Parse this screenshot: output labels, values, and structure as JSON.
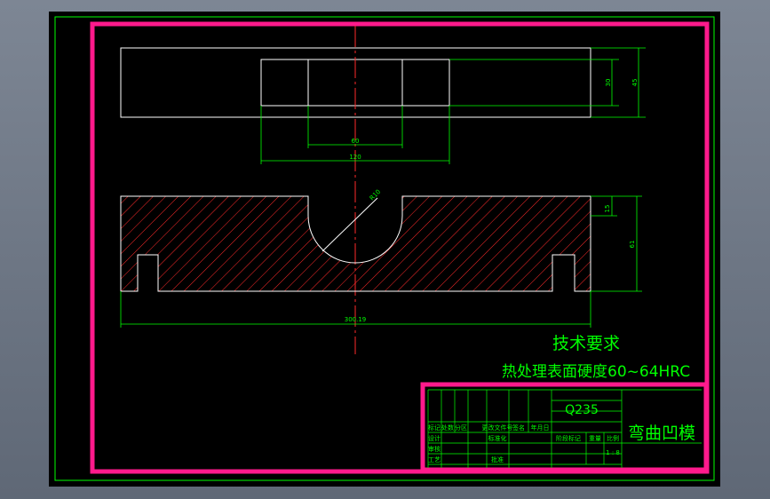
{
  "drawing": {
    "title": "弯曲凹模",
    "material": "Q235",
    "scale": "1 : 8"
  },
  "technical_requirements": {
    "heading": "技术要求",
    "line1": "热处理表面硬度60~64HRC"
  },
  "dimensions": {
    "dim_30": "30",
    "dim_45": "45",
    "dim_60": "60",
    "dim_120": "120",
    "dim_r": "R10",
    "dim_15": "15",
    "dim_61": "61",
    "dim_300": "300.19"
  },
  "title_block": {
    "revision_row": [
      "标记",
      "处数",
      "分区",
      "更改文件号",
      "签名",
      "年月日"
    ],
    "design": "设计",
    "standardize": "标准化",
    "check": "审核",
    "process": "工艺",
    "approve": "批准",
    "stage_headers": [
      "阶段标记",
      "重量",
      "比例"
    ]
  },
  "colors": {
    "background": "#000000",
    "border": "#ff1a8c",
    "frame": "#00ff00",
    "outline": "#ffffff",
    "hatch": "#ff2a2a",
    "centerline": "#ff2a2a",
    "text": "#00ff00"
  }
}
